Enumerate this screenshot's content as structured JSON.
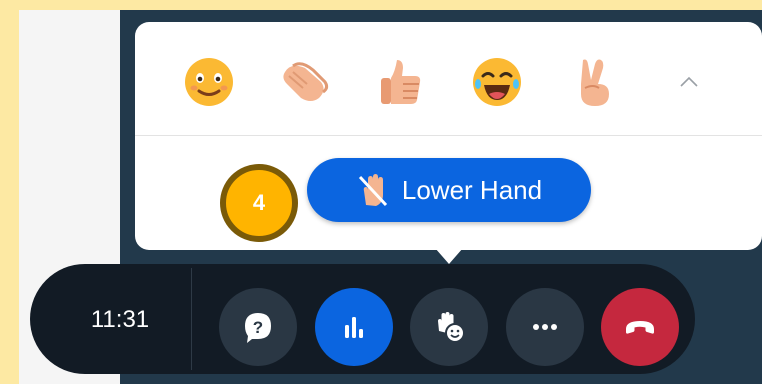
{
  "reactions": {
    "emojis": [
      {
        "name": "smiling-face-icon"
      },
      {
        "name": "clapping-hands-icon"
      },
      {
        "name": "thumbs-up-icon"
      },
      {
        "name": "laughing-face-icon"
      },
      {
        "name": "victory-hand-icon"
      }
    ],
    "lower_hand_label": "Lower Hand"
  },
  "annotation": {
    "step": "4"
  },
  "controls": {
    "clock": "11:31",
    "buttons": [
      "question-icon",
      "poll-icon",
      "raise-hand-reaction-icon",
      "more-options-icon",
      "end-call-icon"
    ]
  },
  "colors": {
    "background": "#fde9a3",
    "meet_bg": "#22394b",
    "bar": "#121b25",
    "button_dark": "#2a3744",
    "accent_blue": "#0b65e0",
    "end_call_red": "#c5283e",
    "badge_fill": "#ffb400",
    "badge_ring": "#7a5a08"
  }
}
